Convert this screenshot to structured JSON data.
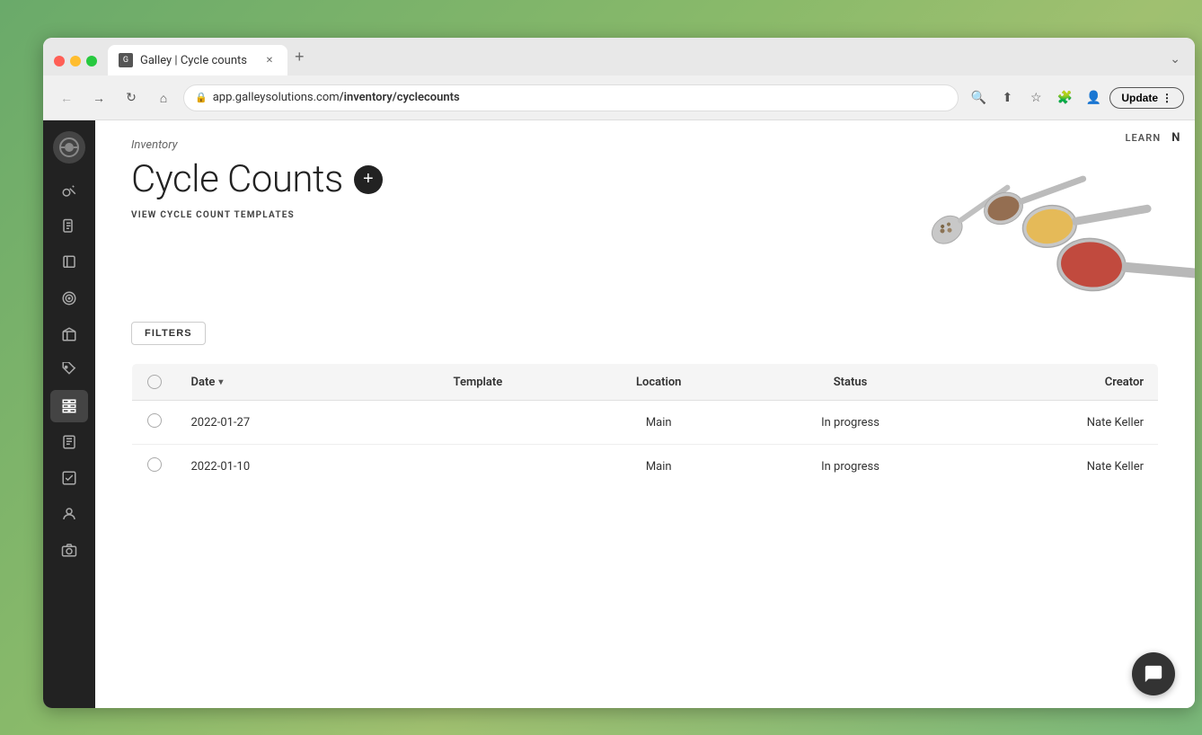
{
  "browser": {
    "tab_title": "Galley | Cycle counts",
    "url_display": "app.galleysolutions.com/inventory/cyclecounts",
    "update_label": "Update"
  },
  "header": {
    "learn_label": "LEARN",
    "n_label": "N",
    "breadcrumb": "Inventory",
    "page_title": "Cycle Counts",
    "templates_link": "VIEW CYCLE COUNT TEMPLATES",
    "filters_label": "FILTERS"
  },
  "table": {
    "columns": [
      {
        "key": "checkbox",
        "label": ""
      },
      {
        "key": "date",
        "label": "Date"
      },
      {
        "key": "template",
        "label": "Template"
      },
      {
        "key": "location",
        "label": "Location"
      },
      {
        "key": "status",
        "label": "Status"
      },
      {
        "key": "creator",
        "label": "Creator"
      }
    ],
    "rows": [
      {
        "date": "2022-01-27",
        "template": "",
        "location": "Main",
        "status": "In progress",
        "creator": "Nate Keller"
      },
      {
        "date": "2022-01-10",
        "template": "",
        "location": "Main",
        "status": "In progress",
        "creator": "Nate Keller"
      }
    ]
  },
  "sidebar": {
    "items": [
      {
        "icon": "🔑",
        "label": "key-icon",
        "active": false
      },
      {
        "icon": "📄",
        "label": "document-icon",
        "active": false
      },
      {
        "icon": "📚",
        "label": "book-icon",
        "active": false
      },
      {
        "icon": "🎯",
        "label": "target-icon",
        "active": false
      },
      {
        "icon": "📦",
        "label": "package-icon",
        "active": false
      },
      {
        "icon": "🏷️",
        "label": "tag-icon",
        "active": false
      },
      {
        "icon": "📊",
        "label": "table-icon",
        "active": true
      },
      {
        "icon": "📖",
        "label": "recipe-icon",
        "active": false
      },
      {
        "icon": "📋",
        "label": "clipboard-icon",
        "active": false
      },
      {
        "icon": "👤",
        "label": "user-icon",
        "active": false
      },
      {
        "icon": "🎥",
        "label": "camera-icon",
        "active": false
      }
    ]
  }
}
